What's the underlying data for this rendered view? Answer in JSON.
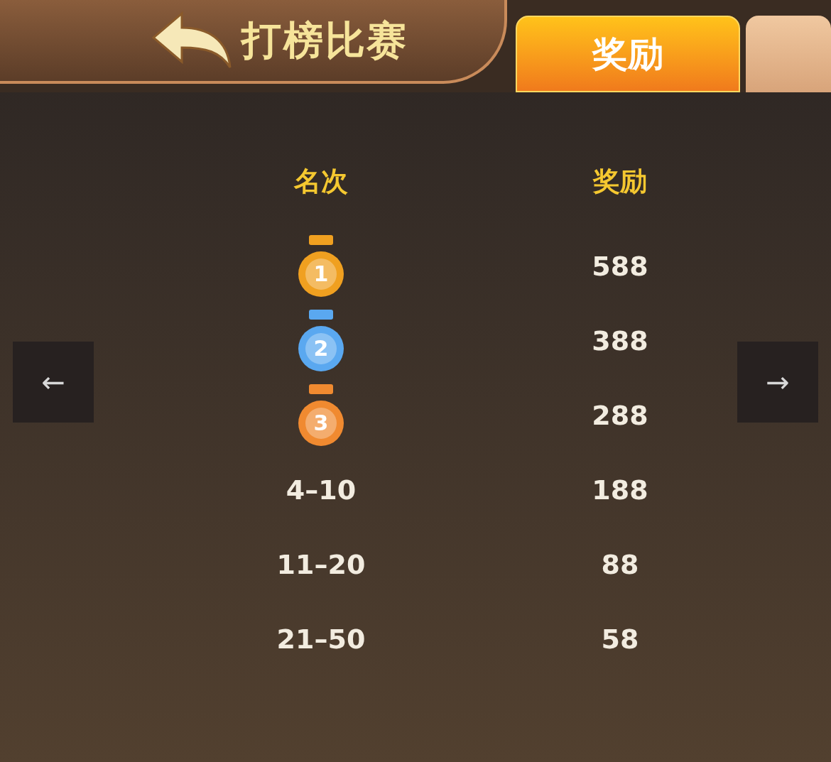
{
  "header": {
    "title": "打榜比赛"
  },
  "tabs": [
    {
      "label": "奖励",
      "selected": true
    },
    {
      "selected": false
    }
  ],
  "table": {
    "columns": [
      "名次",
      "奖励"
    ],
    "rows": [
      {
        "kind": "medal",
        "rank": "1",
        "color": "#f0a020",
        "reward": "588"
      },
      {
        "kind": "medal",
        "rank": "2",
        "color": "#5aa8f0",
        "reward": "388"
      },
      {
        "kind": "medal",
        "rank": "3",
        "color": "#f08a30",
        "reward": "288"
      },
      {
        "kind": "range",
        "rank": "4–10",
        "reward": "188"
      },
      {
        "kind": "range",
        "rank": "11–20",
        "reward": "88"
      },
      {
        "kind": "range",
        "rank": "21–50",
        "reward": "58"
      }
    ]
  },
  "nav": {
    "previous": "←",
    "next": "→"
  }
}
